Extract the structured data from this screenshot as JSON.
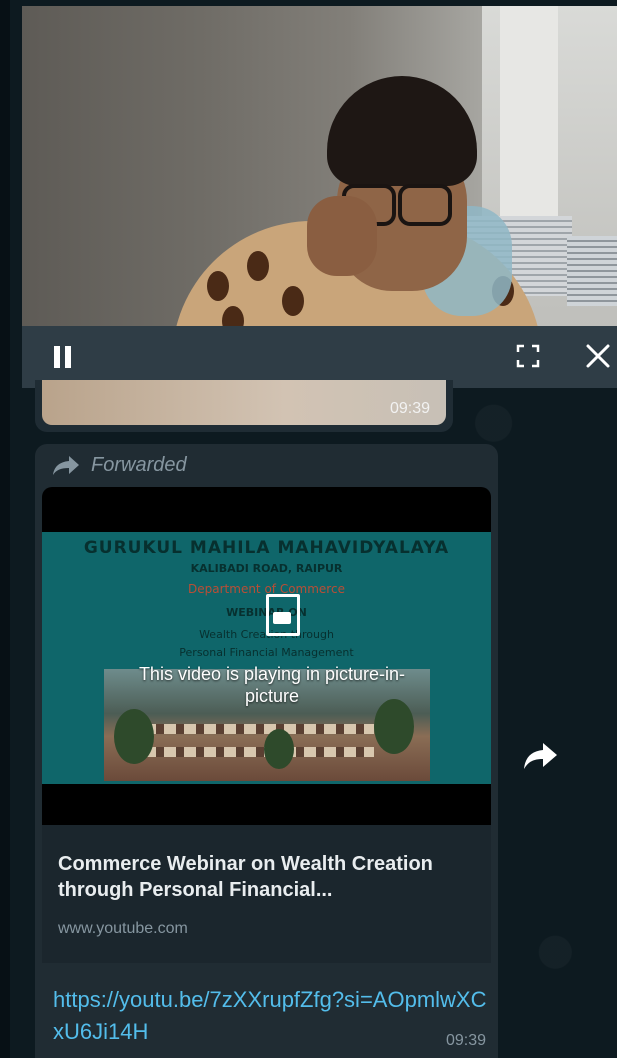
{
  "pip_video": {
    "controls": {
      "pause_icon": "pause-icon",
      "fullscreen_icon": "fullscreen-icon",
      "close_icon": "close-icon"
    }
  },
  "previous_message": {
    "time": "09:39"
  },
  "forwarded_message": {
    "forwarded_label": "Forwarded",
    "thumbnail": {
      "college_name": "GURUKUL MAHILA MAHAVIDYALAYA",
      "address": "KALIBADI ROAD, RAIPUR",
      "department": "Department of Commerce",
      "event": "WEBINAR ON",
      "topic_line1": "Wealth Creation through",
      "topic_line2": "Personal Financial Management",
      "pip_notice": "This video is playing in picture-in-picture"
    },
    "link_preview": {
      "title": "Commerce Webinar on Wealth Creation through Personal Financial...",
      "domain": "www.youtube.com"
    },
    "link": "https://youtu.be/7zXXrupfZfg?si=AOpmlwXCxU6Ji14H",
    "time": "09:39"
  },
  "share_icon": "share-arrow-icon",
  "colors": {
    "bubble": "#202c33",
    "link": "#53bdeb",
    "meta": "#8696a0",
    "thumbnail_teal": "#0f666a",
    "controls_bar": "#2f3d46"
  }
}
